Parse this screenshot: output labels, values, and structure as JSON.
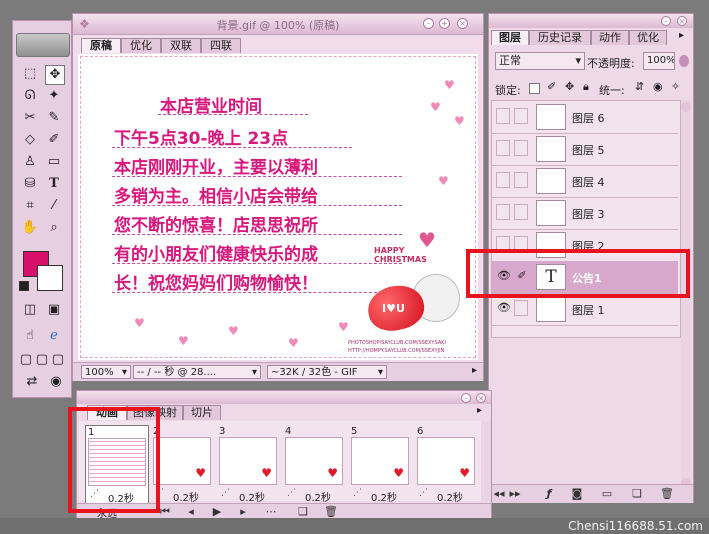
{
  "doc_window": {
    "title": "背景.gif @ 100% (原稿)",
    "tabs": [
      {
        "label": "原稿",
        "active": true
      },
      {
        "label": "优化",
        "active": false
      },
      {
        "label": "双联",
        "active": false
      },
      {
        "label": "四联",
        "active": false
      }
    ],
    "canvas_text": {
      "heading": "本店营业时间",
      "lines": [
        "下午5点30-晚上 23点",
        "本店刚刚开业，主要以薄利",
        "多销为主。相信小店会带给",
        "您不断的惊喜！店思思祝所",
        "有的小朋友们健康快乐的成",
        "长！祝您妈妈们购物愉快！"
      ],
      "christmas_line1": "HAPPY",
      "christmas_line2": "CHRISTMAS",
      "watermark": "PHOTOSHOP/SAYCLUB.COM/SSEXYSAKI",
      "watermark2": "HTTP://HOMPY.SAYCLUB.COM/SSEXYJIN"
    },
    "status": {
      "zoom": "100%",
      "time": "-- / -- 秒 @ 28....",
      "size": "~32K / 32色 - GIF"
    }
  },
  "layers_panel": {
    "tabs": [
      {
        "label": "图层",
        "active": true
      },
      {
        "label": "历史记录",
        "active": false
      },
      {
        "label": "动作",
        "active": false
      },
      {
        "label": "优化",
        "active": false
      }
    ],
    "blend_mode": "正常",
    "opacity_label": "不透明度:",
    "opacity_value": "100%",
    "lock_label": "锁定:",
    "unify_label": "统一:",
    "layers": [
      {
        "name": "图层 6",
        "type": "image",
        "visible": false,
        "selected": false
      },
      {
        "name": "图层 5",
        "type": "image",
        "visible": false,
        "selected": false
      },
      {
        "name": "图层 4",
        "type": "image",
        "visible": false,
        "selected": false
      },
      {
        "name": "图层 3",
        "type": "image",
        "visible": false,
        "selected": false
      },
      {
        "name": "图层 2",
        "type": "image",
        "visible": false,
        "selected": false
      },
      {
        "name": "公告1",
        "type": "text",
        "visible": true,
        "selected": true
      },
      {
        "name": "图层 1",
        "type": "image",
        "visible": true,
        "selected": false
      }
    ]
  },
  "animation_panel": {
    "tabs": [
      {
        "label": "动画",
        "active": true
      },
      {
        "label": "图像映射",
        "active": false
      },
      {
        "label": "切片",
        "active": false
      }
    ],
    "frames": [
      {
        "num": "1",
        "delay": "0.2秒"
      },
      {
        "num": "2",
        "delay": "0.2秒"
      },
      {
        "num": "3",
        "delay": "0.2秒"
      },
      {
        "num": "4",
        "delay": "0.2秒"
      },
      {
        "num": "5",
        "delay": "0.2秒"
      },
      {
        "num": "6",
        "delay": "0.2秒"
      }
    ],
    "loop_label": "永远"
  },
  "footer_watermark": "Chensi116688.51.com",
  "colors": {
    "foreground": "#d8106a",
    "background": "#ffffff",
    "canvas_text": "#d8187c",
    "highlight": "#e8131d",
    "selected_layer": "#d8a8cc"
  }
}
